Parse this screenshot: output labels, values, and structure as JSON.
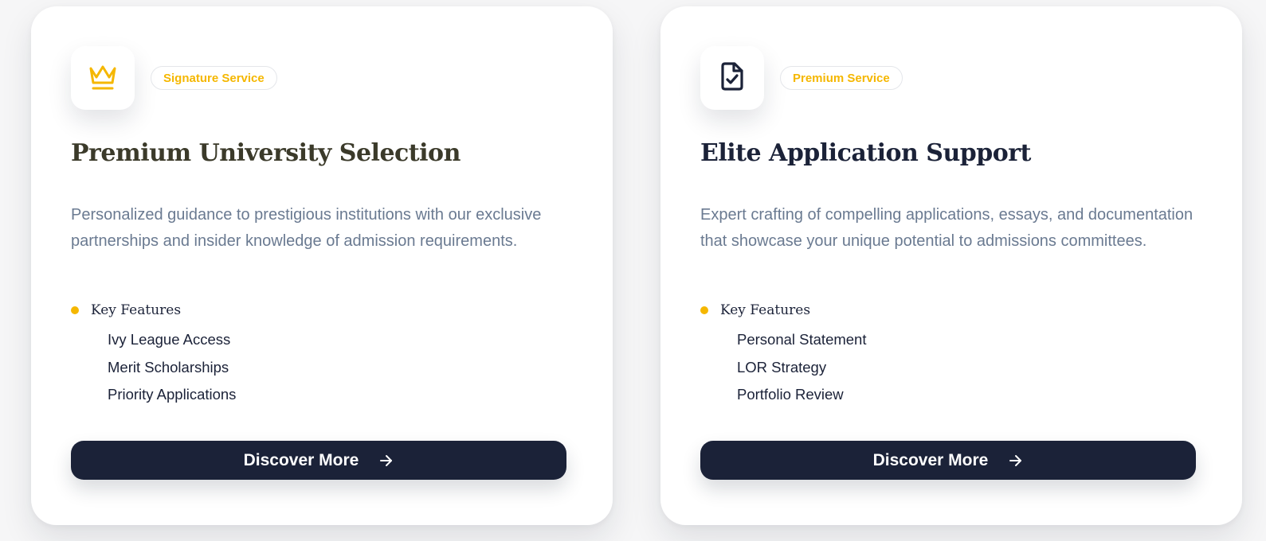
{
  "cards": [
    {
      "badge": "Signature Service",
      "icon": "crown-icon",
      "title": "Premium University Selection",
      "description": "Personalized guidance to prestigious institutions with our exclusive partnerships and insider knowledge of admission requirements.",
      "features_label": "Key Features",
      "features": [
        "Ivy League Access",
        "Merit Scholarships",
        "Priority Applications"
      ],
      "cta": "Discover More"
    },
    {
      "badge": "Premium Service",
      "icon": "document-check-icon",
      "title": "Elite Application Support",
      "description": "Expert crafting of compelling applications, essays, and documentation that showcase your unique potential to admissions committees.",
      "features_label": "Key Features",
      "features": [
        "Personal Statement",
        "LOR Strategy",
        "Portfolio Review"
      ],
      "cta": "Discover More"
    }
  ],
  "colors": {
    "accent": "#f5b700",
    "navy": "#1b2238",
    "muted_text": "#6a7a91",
    "card_bg": "#ffffff",
    "page_bg": "#f6f6f7"
  }
}
